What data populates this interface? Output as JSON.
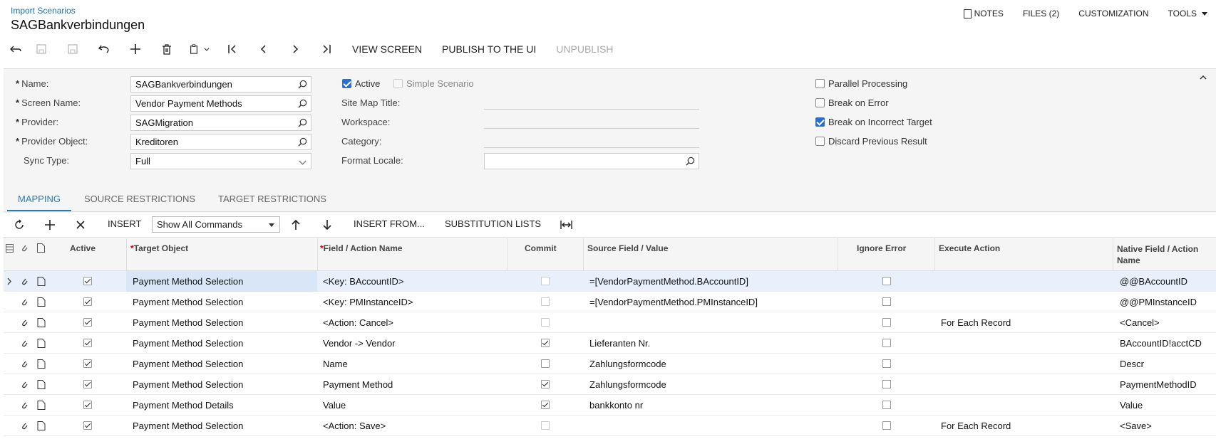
{
  "header": {
    "breadcrumb": "Import Scenarios",
    "title": "SAGBankverbindungen",
    "links": {
      "notes": "NOTES",
      "files": "FILES (2)",
      "customization": "CUSTOMIZATION",
      "tools": "TOOLS"
    }
  },
  "toolbar": {
    "view_screen": "VIEW SCREEN",
    "publish": "PUBLISH TO THE UI",
    "unpublish": "UNPUBLISH"
  },
  "form": {
    "name_label": "Name:",
    "name_value": "SAGBankverbindungen",
    "screen_label": "Screen Name:",
    "screen_value": "Vendor Payment Methods",
    "provider_label": "Provider:",
    "provider_value": "SAGMigration",
    "provider_object_label": "Provider Object:",
    "provider_object_value": "Kreditoren",
    "sync_label": "Sync Type:",
    "sync_value": "Full",
    "active_label": "Active",
    "simple_label": "Simple Scenario",
    "sitemap_label": "Site Map Title:",
    "workspace_label": "Workspace:",
    "category_label": "Category:",
    "format_label": "Format Locale:",
    "parallel_label": "Parallel Processing",
    "break_error_label": "Break on Error",
    "break_target_label": "Break on Incorrect Target",
    "discard_label": "Discard Previous Result"
  },
  "tabs": {
    "mapping": "MAPPING",
    "source": "SOURCE RESTRICTIONS",
    "target": "TARGET RESTRICTIONS"
  },
  "grid_toolbar": {
    "insert": "INSERT",
    "filter_value": "Show All Commands",
    "insert_from": "INSERT FROM...",
    "substitution": "SUBSTITUTION LISTS"
  },
  "grid": {
    "headers": {
      "active": "Active",
      "target_object": "Target Object",
      "field_action": "Field / Action Name",
      "commit": "Commit",
      "source_field": "Source Field / Value",
      "ignore_error": "Ignore Error",
      "execute_action": "Execute Action",
      "native_line1": "Native Field / Action",
      "native_line2": "Name"
    },
    "rows": [
      {
        "target": "Payment Method Selection",
        "field": "<Key: BAccountID>",
        "commit": false,
        "commit_dis": true,
        "source": "=[VendorPaymentMethod.BAccountID]",
        "exec": "",
        "native": "@@BAccountID"
      },
      {
        "target": "Payment Method Selection",
        "field": "<Key: PMInstanceID>",
        "commit": false,
        "commit_dis": true,
        "source": "=[VendorPaymentMethod.PMInstanceID]",
        "exec": "",
        "native": "@@PMInstanceID"
      },
      {
        "target": "Payment Method Selection",
        "field": "<Action: Cancel>",
        "commit": false,
        "commit_dis": true,
        "source": "",
        "exec": "For Each Record",
        "native": "<Cancel>"
      },
      {
        "target": "Payment Method Selection",
        "field": "Vendor -> Vendor",
        "commit": true,
        "commit_dis": false,
        "source": "Lieferanten Nr.",
        "exec": "",
        "native": "BAccountID!acctCD"
      },
      {
        "target": "Payment Method Selection",
        "field": "Name",
        "commit": false,
        "commit_dis": false,
        "source": "Zahlungsformcode",
        "exec": "",
        "native": "Descr"
      },
      {
        "target": "Payment Method Selection",
        "field": "Payment Method",
        "commit": true,
        "commit_dis": false,
        "source": "Zahlungsformcode",
        "exec": "",
        "native": "PaymentMethodID"
      },
      {
        "target": "Payment Method Details",
        "field": "Value",
        "commit": true,
        "commit_dis": false,
        "source": "bankkonto nr",
        "exec": "",
        "native": "Value"
      },
      {
        "target": "Payment Method Selection",
        "field": "<Action: Save>",
        "commit": false,
        "commit_dis": true,
        "source": "",
        "exec": "For Each Record",
        "native": "<Save>"
      }
    ]
  }
}
